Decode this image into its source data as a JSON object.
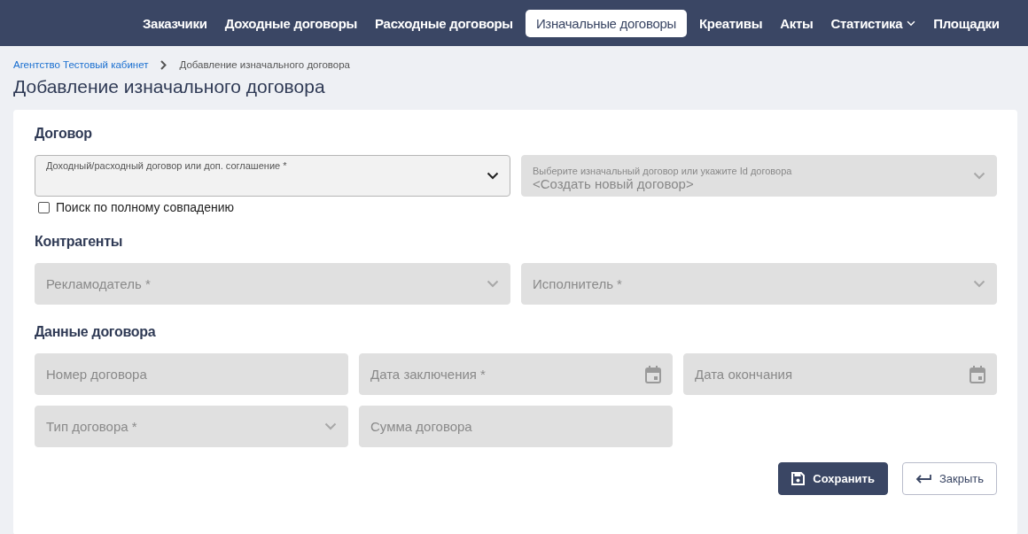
{
  "nav": {
    "items": [
      {
        "label": "Заказчики",
        "selected": false,
        "has_menu": false
      },
      {
        "label": "Доходные договоры",
        "selected": false,
        "has_menu": false
      },
      {
        "label": "Расходные договоры",
        "selected": false,
        "has_menu": false
      },
      {
        "label": "Изначальные договоры",
        "selected": true,
        "has_menu": false
      },
      {
        "label": "Креативы",
        "selected": false,
        "has_menu": false
      },
      {
        "label": "Акты",
        "selected": false,
        "has_menu": false
      },
      {
        "label": "Статистика",
        "selected": false,
        "has_menu": true
      },
      {
        "label": "Площадки",
        "selected": false,
        "has_menu": false
      }
    ]
  },
  "breadcrumb": [
    {
      "label": "Агентство Тестовый кабинет",
      "kind": "link"
    },
    {
      "label": "Добавление изначального договора",
      "kind": "current"
    }
  ],
  "page_title": "Добавление изначального договора",
  "sections": [
    {
      "title": "Договор",
      "rows": [
        {
          "fields": [
            {
              "kind": "select",
              "label": "Доходный/расходный договор или доп. соглашение *",
              "disabled": false
            },
            {
              "kind": "select",
              "label": "Выберите изначальный договор или укажите Id договора",
              "value": "<Создать новый договор>",
              "disabled": true
            }
          ]
        }
      ],
      "checkbox": {
        "label": "Поиск по полному совпадению",
        "checked": false
      }
    },
    {
      "title": "Контрагенты",
      "rows": [
        {
          "fields": [
            {
              "kind": "select",
              "placeholder": "Рекламодатель *",
              "disabled": true
            },
            {
              "kind": "select",
              "placeholder": "Исполнитель *",
              "disabled": true
            }
          ]
        }
      ]
    },
    {
      "title": "Данные договора",
      "rows": [
        {
          "fields": [
            {
              "kind": "input",
              "placeholder": "Номер договора",
              "disabled": true
            },
            {
              "kind": "date",
              "placeholder": "Дата заключения *",
              "disabled": true
            },
            {
              "kind": "date",
              "placeholder": "Дата окончания",
              "disabled": true
            }
          ]
        },
        {
          "fields": [
            {
              "kind": "select",
              "placeholder": "Тип договора *",
              "disabled": true
            },
            {
              "kind": "input",
              "placeholder": "Сумма договора",
              "disabled": true
            }
          ]
        }
      ]
    }
  ],
  "buttons": [
    {
      "label": "Сохранить",
      "kind": "primary"
    },
    {
      "label": "Закрыть",
      "kind": "secondary"
    }
  ]
}
